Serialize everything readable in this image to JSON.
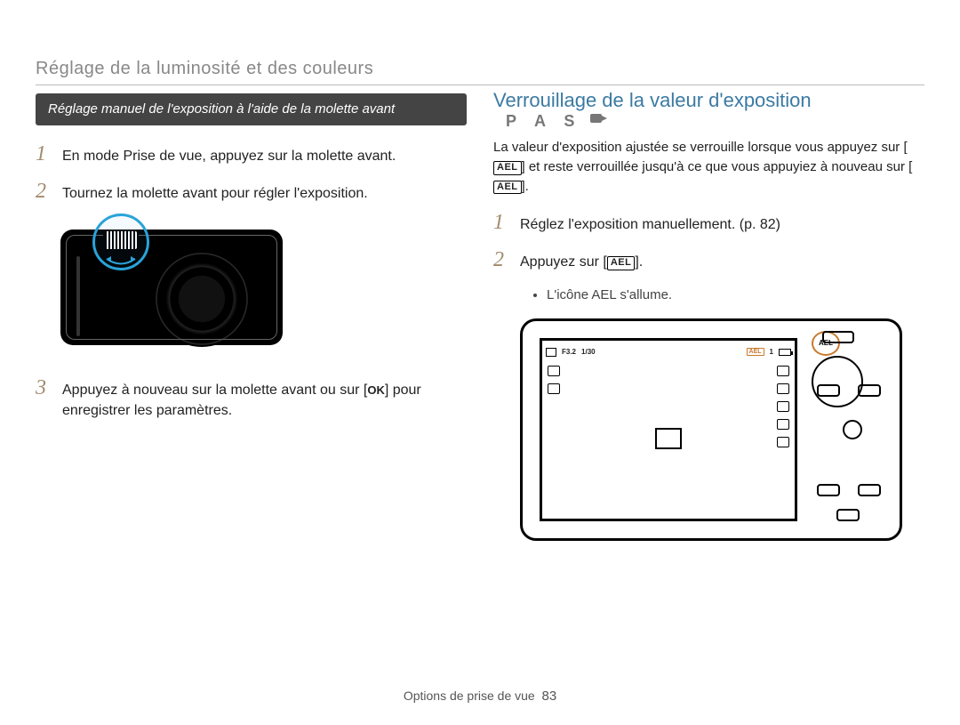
{
  "header": "Réglage de la luminosité et des couleurs",
  "left": {
    "subheading": "Réglage manuel de l'exposition à l'aide de la molette avant",
    "steps": [
      "En mode Prise de vue, appuyez sur la molette avant.",
      "Tournez la molette avant pour régler l'exposition."
    ],
    "step3_a": "Appuyez à nouveau sur la molette avant ou sur [",
    "ok": "OK",
    "step3_b": "] pour enregistrer les paramètres."
  },
  "right": {
    "heading": "Verrouillage de la valeur d'exposition",
    "modes": "P A S",
    "intro_a": "La valeur d'exposition ajustée se verrouille lorsque vous appuyez sur [",
    "intro_b": "] et reste verrouillée jusqu'à ce que vous appuyiez à nouveau sur [",
    "intro_c": "].",
    "ael": "AEL",
    "step1": "Réglez l'exposition manuellement. (p. 82)",
    "step2_a": "Appuyez sur [",
    "step2_b": "].",
    "bullet": "L'icône AEL s'allume.",
    "screen": {
      "fstop": "F3.2",
      "shutter": "1/30",
      "count": "1",
      "ael_badge": "AEL",
      "btn_ael": "AEL"
    }
  },
  "footer": {
    "label": "Options de prise de vue",
    "page": "83"
  },
  "nums": {
    "n1": "1",
    "n2": "2",
    "n3": "3"
  }
}
